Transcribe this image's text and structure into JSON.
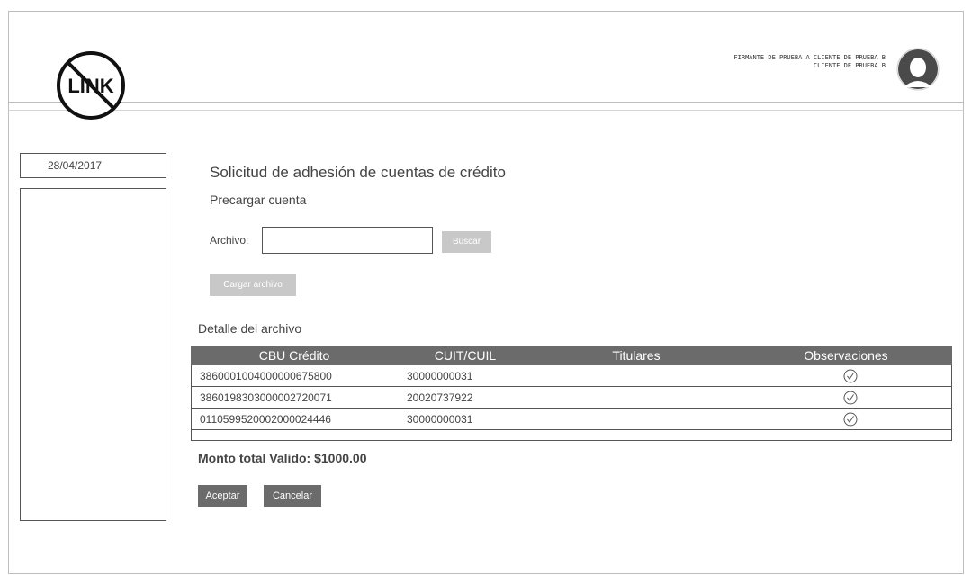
{
  "header": {
    "logo_text": "LINK",
    "user_line1": "FIRMANTE DE PRUEBA A CLIENTE DE PRUEBA B",
    "user_line2": "CLIENTE DE PRUEBA B"
  },
  "sidebar": {
    "date": "28/04/2017"
  },
  "main": {
    "title": "Solicitud de adhesión de cuentas de crédito",
    "subtitle": "Precargar cuenta",
    "file_label": "Archivo:",
    "file_value": "",
    "search_button": "Buscar",
    "load_button": "Cargar archivo",
    "detail_label": "Detalle del archivo",
    "table": {
      "columns": [
        "CBU Crédito",
        "CUIT/CUIL",
        "Titulares",
        "Observaciones"
      ],
      "rows": [
        {
          "cbu": "3860001004000000675800",
          "cuit": "30000000031",
          "titulares": "",
          "obs_icon": "check-circle-icon"
        },
        {
          "cbu": "3860198303000002720071",
          "cuit": "20020737922",
          "titulares": "",
          "obs_icon": "check-circle-icon"
        },
        {
          "cbu": "0110599520002000024446",
          "cuit": "30000000031",
          "titulares": "",
          "obs_icon": "check-circle-icon"
        }
      ]
    },
    "total": "Monto total Valido: $1000.00",
    "accept_button": "Aceptar",
    "cancel_button": "Cancelar"
  },
  "colors": {
    "header_bg": "#6b6b6b",
    "disabled_button": "#c8c8c8",
    "border": "#555555"
  }
}
